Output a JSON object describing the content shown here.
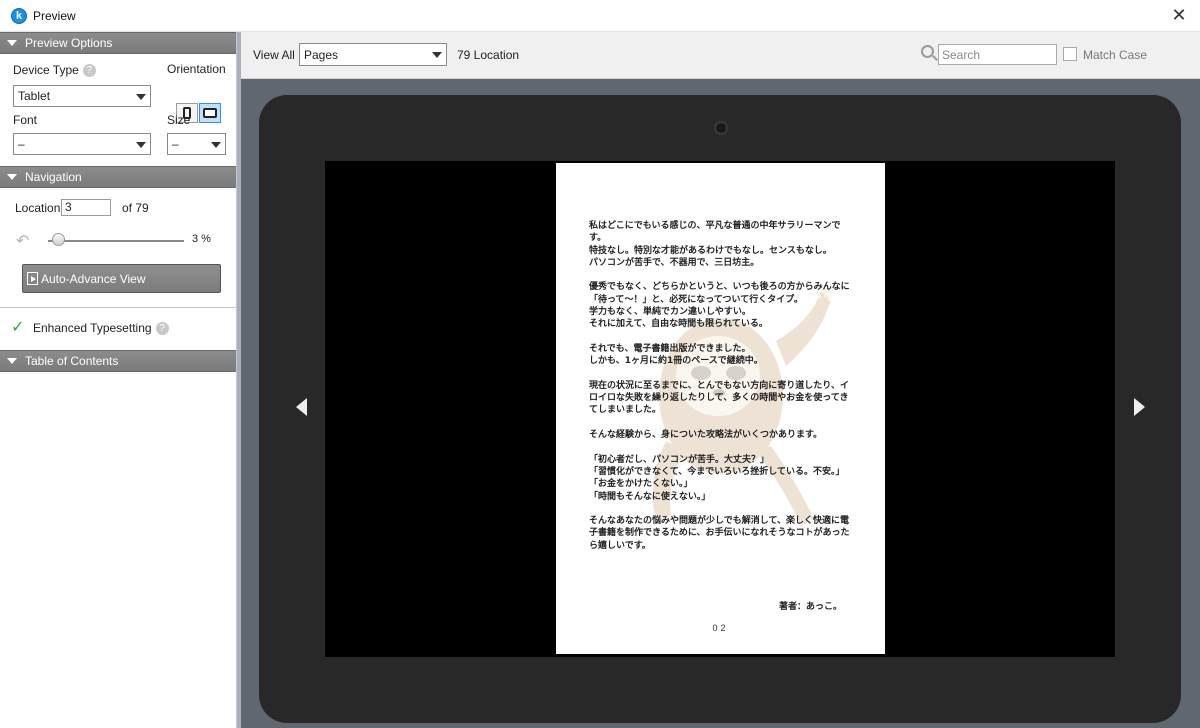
{
  "window": {
    "title": "Preview",
    "app_icon_letter": "k",
    "close_glyph": "✕"
  },
  "left_panel": {
    "preview_options": {
      "header": "Preview Options",
      "device_type_label": "Device Type",
      "device_type_value": "Tablet",
      "orientation_label": "Orientation",
      "orientation_selected": "landscape",
      "font_label": "Font",
      "font_value": "–",
      "size_label": "Size",
      "size_value": "–"
    },
    "navigation": {
      "header": "Navigation",
      "location_label": "Location",
      "location_value": "3",
      "of_label": "of 79",
      "progress_text": "3 %",
      "progress_fraction": 0.03,
      "auto_advance_label": "Auto-Advance View"
    },
    "enhanced_typesetting": {
      "label": "Enhanced Typesetting"
    },
    "toc": {
      "header": "Table of Contents"
    }
  },
  "toolbar": {
    "view_all_label": "View All",
    "view_select_value": "Pages",
    "location_count": "79 Location",
    "search_placeholder": "Search",
    "match_case_label": "Match Case"
  },
  "page": {
    "body": "私はどこにでもいる感じの、平凡な普通の中年サラリーマンです。\n特技なし。特別な才能があるわけでもなし。センスもなし。\nパソコンが苦手で、不器用で、三日坊主。\n\n優秀でもなく、どちらかというと、いつも後ろの方からみんなに「待って〜！」と、必死になってついて行くタイプ。\n学力もなく、単純でカン違いしやすい。\nそれに加えて、自由な時間も限られている。\n\nそれでも、電子書籍出版ができました。\nしかも、1ヶ月に約1冊のペースで継続中。\n\n現在の状況に至るまでに、とんでもない方向に寄り道したり、イロイロな失敗を繰り返したりして、多くの時間やお金を使ってきてしまいました。\n\nそんな経験から、身についた攻略法がいくつかあります。\n\n「初心者だし、パソコンが苦手。大丈夫？」\n「習慣化ができなくて、今までいろいろ挫折している。不安。」\n「お金をかけたくない。」\n「時間もそんなに使えない。」\n\nそんなあなたの悩みや問題が少しでも解消して、楽しく快適に電子書籍を制作できるために、お手伝いになれそうなコトがあったら嬉しいです。",
    "author": "著者：あっこ。",
    "page_number": "02"
  }
}
